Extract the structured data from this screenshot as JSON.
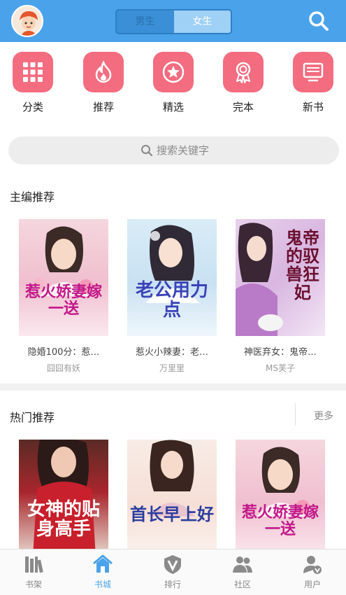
{
  "header": {
    "tabs": {
      "male": "男生",
      "female": "女生"
    },
    "accent": "#4aa3ea"
  },
  "categories": [
    {
      "label": "分类",
      "icon": "grid-icon"
    },
    {
      "label": "推荐",
      "icon": "flame-icon"
    },
    {
      "label": "精选",
      "icon": "star-icon"
    },
    {
      "label": "完本",
      "icon": "ribbon-icon"
    },
    {
      "label": "新书",
      "icon": "monitor-icon"
    }
  ],
  "search": {
    "placeholder": "搜索关键字"
  },
  "editor_picks": {
    "title": "主编推荐",
    "books": [
      {
        "title": "隐婚100分：惹…",
        "author": "囧囧有妖",
        "cover_text": "惹火娇妻嫁一送"
      },
      {
        "title": "惹火小辣妻：老…",
        "author": "万里里",
        "cover_text": "老公用力点"
      },
      {
        "title": "神医弃女：鬼帝…",
        "author": "MS芙子",
        "cover_text": "鬼帝的驭兽狂妃"
      }
    ]
  },
  "hot_picks": {
    "title": "热门推荐",
    "more": "更多",
    "books": [
      {
        "cover_text": "女神的贴身高手"
      },
      {
        "cover_text": "首长早上好"
      },
      {
        "cover_text": "惹火娇妻嫁一送"
      }
    ]
  },
  "nav": [
    {
      "label": "书架",
      "icon": "bookshelf-icon"
    },
    {
      "label": "书城",
      "icon": "home-icon"
    },
    {
      "label": "排行",
      "icon": "ranking-icon"
    },
    {
      "label": "社区",
      "icon": "community-icon"
    },
    {
      "label": "用户",
      "icon": "user-icon"
    }
  ]
}
